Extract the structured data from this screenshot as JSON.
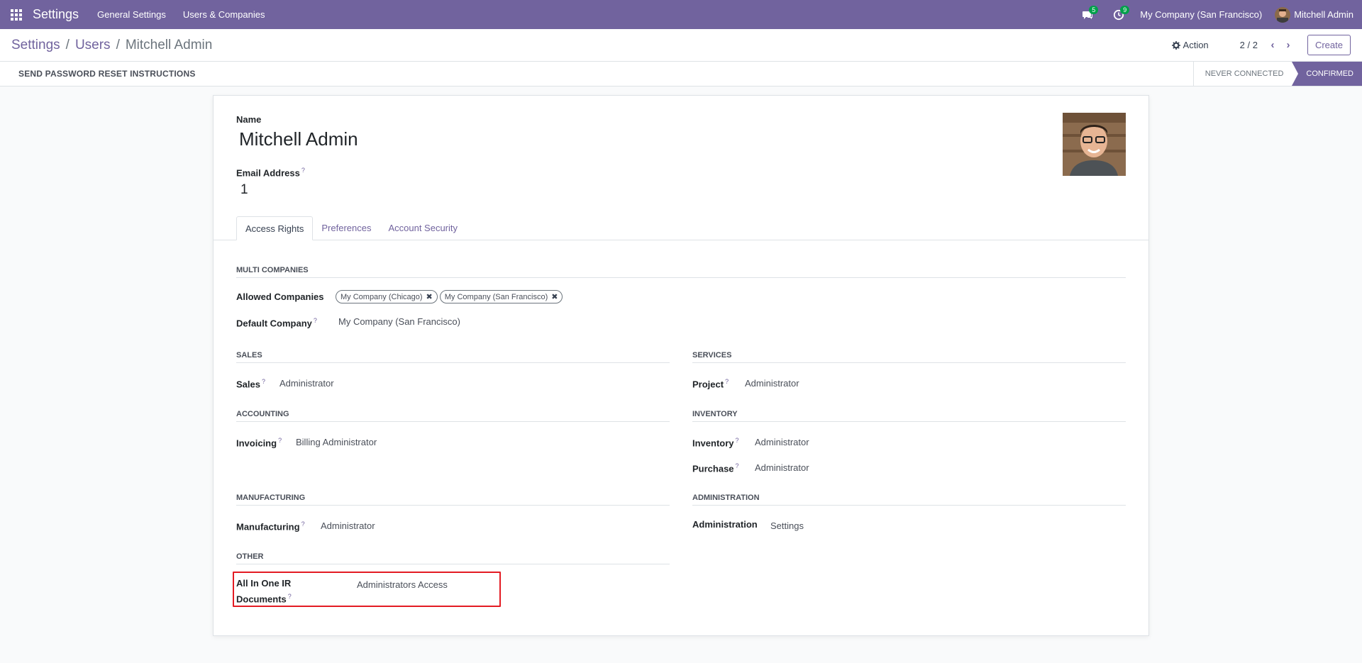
{
  "navbar": {
    "app_title": "Settings",
    "menus": [
      "General Settings",
      "Users & Companies"
    ],
    "messages_count": "5",
    "activities_count": "9",
    "company": "My Company (San Francisco)",
    "user_name": "Mitchell Admin",
    "bg_color": "#71639e"
  },
  "breadcrumb": {
    "items": [
      "Settings",
      "Users"
    ],
    "current": "Mitchell Admin"
  },
  "control": {
    "action_label": "Action",
    "pager": "2 / 2",
    "create_label": "Create"
  },
  "statusbar": {
    "reset_label": "SEND PASSWORD RESET INSTRUCTIONS",
    "stages": [
      "NEVER CONNECTED",
      "CONFIRMED"
    ],
    "active_stage": "CONFIRMED"
  },
  "form": {
    "name_label": "Name",
    "name_value": "Mitchell Admin",
    "email_label": "Email Address",
    "email_value": "1",
    "help_mark": "?"
  },
  "tabs": [
    "Access Rights",
    "Preferences",
    "Account Security"
  ],
  "access": {
    "multi_companies": {
      "title": "MULTI COMPANIES",
      "allowed_label": "Allowed Companies",
      "allowed_tags": [
        "My Company (Chicago)",
        "My Company (San Francisco)"
      ],
      "default_label": "Default Company",
      "default_value": "My Company (San Francisco)"
    },
    "sales": {
      "title": "SALES",
      "label": "Sales",
      "value": "Administrator"
    },
    "services": {
      "title": "SERVICES",
      "label": "Project",
      "value": "Administrator"
    },
    "accounting": {
      "title": "ACCOUNTING",
      "label": "Invoicing",
      "value": "Billing Administrator"
    },
    "inventory": {
      "title": "INVENTORY",
      "inventory_label": "Inventory",
      "inventory_value": "Administrator",
      "purchase_label": "Purchase",
      "purchase_value": "Administrator"
    },
    "manufacturing": {
      "title": "MANUFACTURING",
      "label": "Manufacturing",
      "value": "Administrator"
    },
    "administration": {
      "title": "ADMINISTRATION",
      "label": "Administration",
      "value": "Settings"
    },
    "other": {
      "title": "OTHER",
      "label_line1": "All In One IR",
      "label_line2": "Documents",
      "value": "Administrators Access"
    }
  },
  "colors": {
    "accent": "#71639e",
    "badge": "#00a04a",
    "highlight": "#e31b23"
  }
}
